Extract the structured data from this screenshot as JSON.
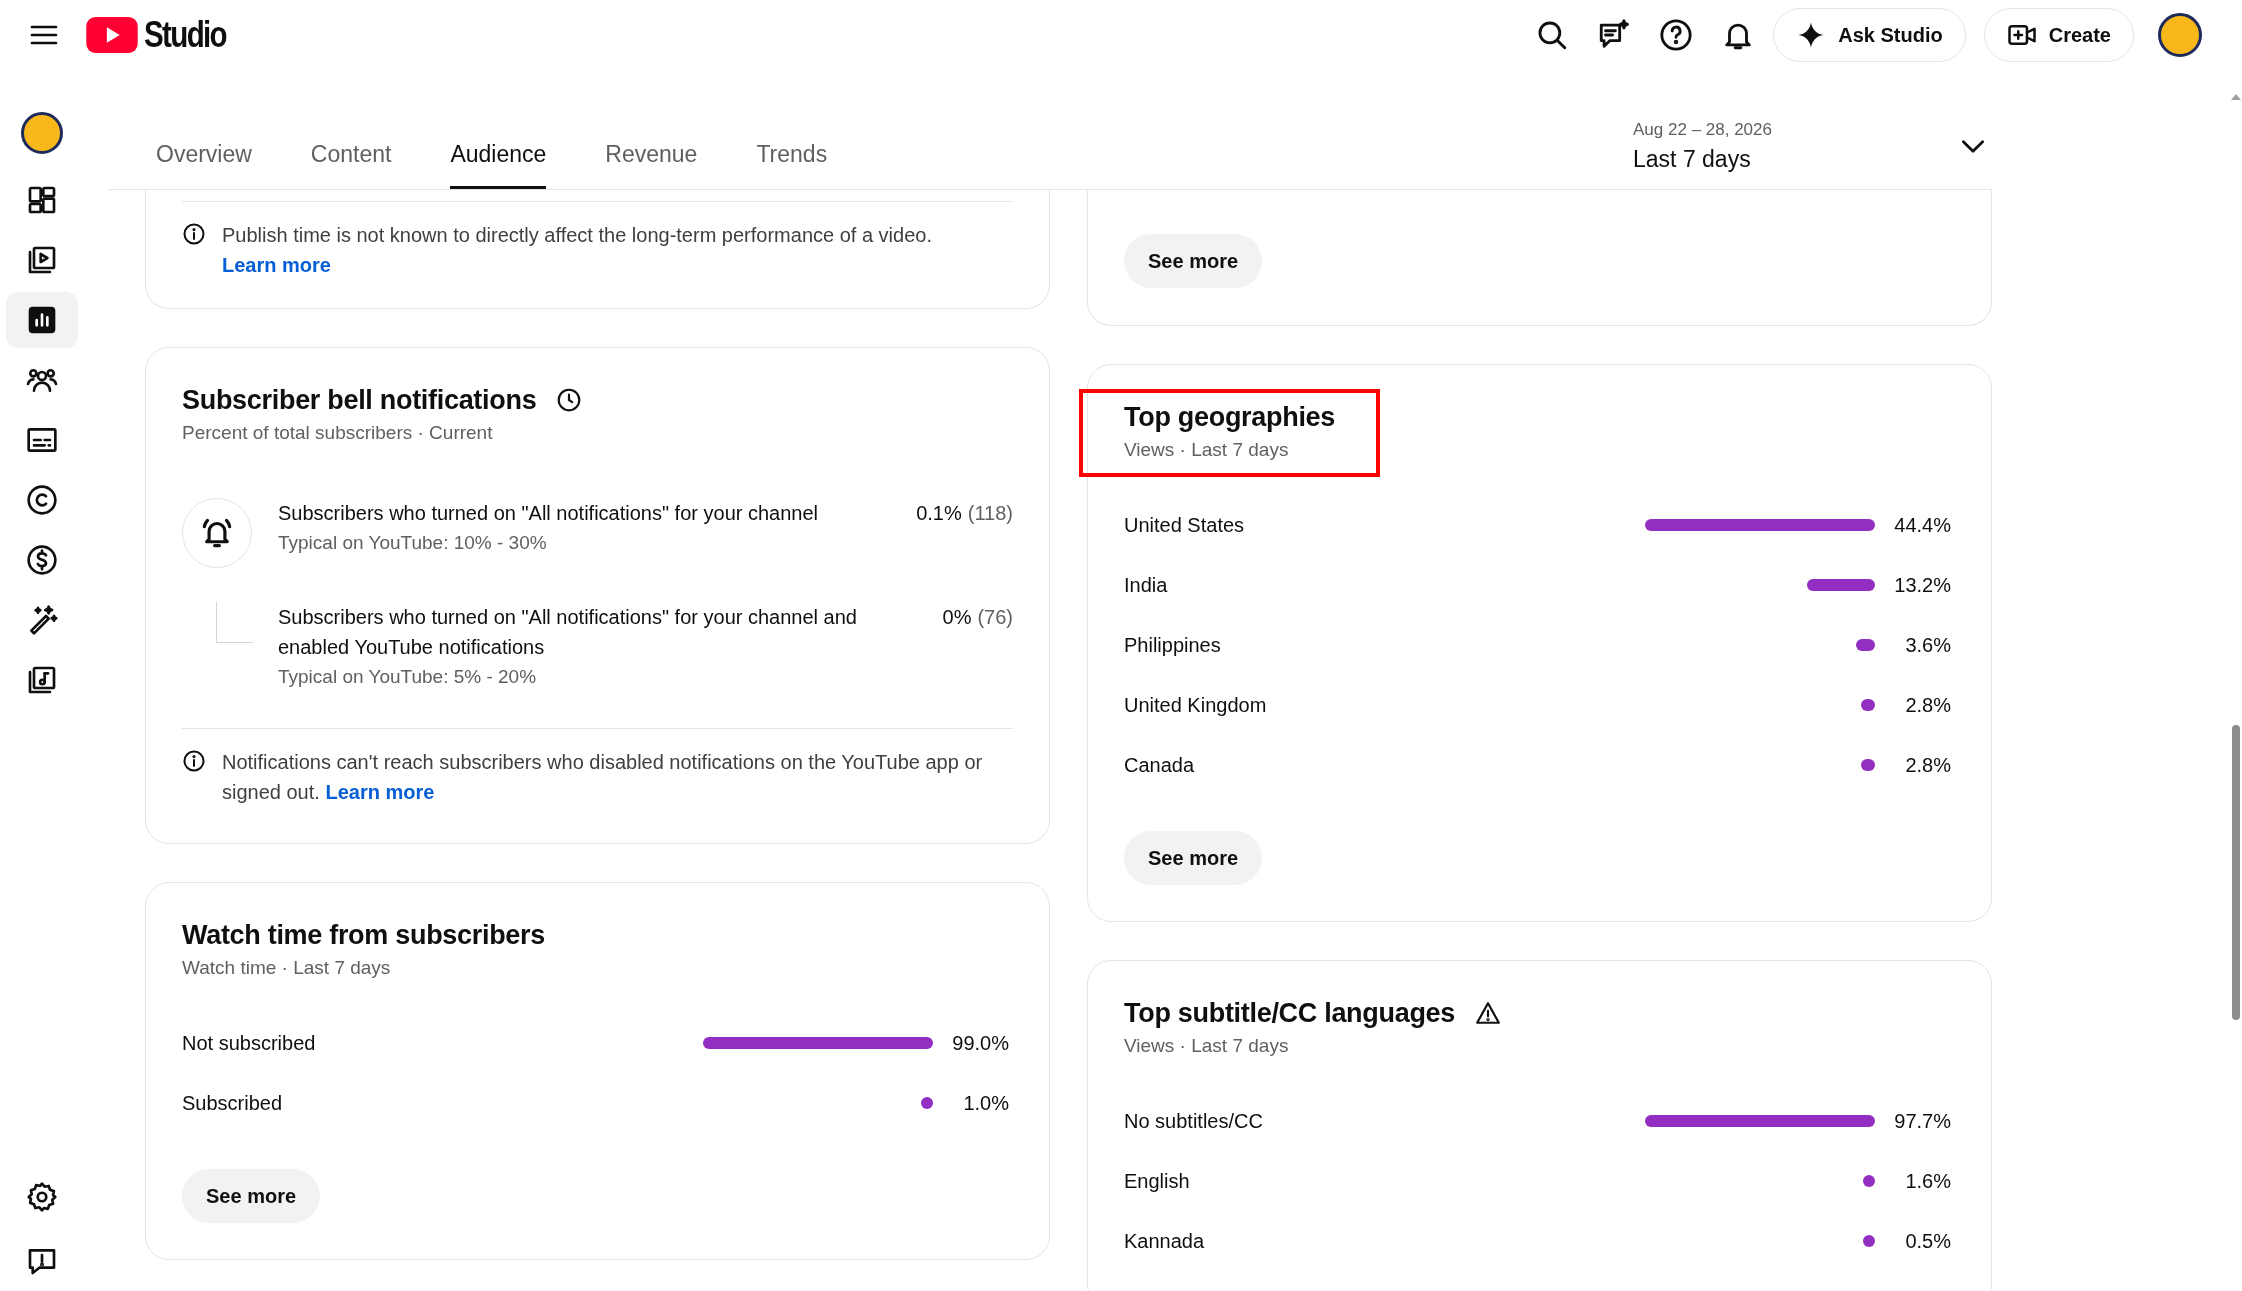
{
  "header": {
    "logo_text": "Studio",
    "ask_button": "Ask Studio",
    "create_button": "Create"
  },
  "sidebar": {
    "items": [
      {
        "kind": "dashboard",
        "selected": false
      },
      {
        "kind": "content",
        "selected": false
      },
      {
        "kind": "analytics",
        "selected": true
      },
      {
        "kind": "community",
        "selected": false
      },
      {
        "kind": "subtitles",
        "selected": false
      },
      {
        "kind": "copyright",
        "selected": false
      },
      {
        "kind": "earn",
        "selected": false
      },
      {
        "kind": "customization",
        "selected": false
      },
      {
        "kind": "audio_library",
        "selected": false
      }
    ],
    "bottom_items": [
      {
        "kind": "settings",
        "selected": false
      },
      {
        "kind": "feedback",
        "selected": false
      }
    ]
  },
  "tabs": [
    {
      "label": "Overview",
      "selected": false
    },
    {
      "label": "Content",
      "selected": false
    },
    {
      "label": "Audience",
      "selected": true
    },
    {
      "label": "Revenue",
      "selected": false
    },
    {
      "label": "Trends",
      "selected": false
    }
  ],
  "date_range": {
    "range": "Aug 22 – 28, 2026",
    "label": "Last 7 days"
  },
  "left_cards": [
    {
      "kind": "note",
      "note": "Publish time is not known to directly affect the long-term performance of a video.",
      "link": "Learn more"
    },
    {
      "kind": "bell",
      "title": "Subscriber bell notifications",
      "title_icon": {
        "kind": "clock"
      },
      "subtitle": "Percent of total subscribers · Current",
      "highlighted": false,
      "rows": [
        {
          "kind": "main",
          "label": "Subscribers who turned on \"All notifications\" for your channel",
          "typical": "Typical on YouTube: 10% - 30%",
          "value": "0.1%",
          "count": "(118)"
        },
        {
          "kind": "sub",
          "label": "Subscribers who turned on \"All notifications\" for your channel and enabled YouTube notifications",
          "typical": "Typical on YouTube: 5% - 20%",
          "value": "0%",
          "count": "(76)"
        }
      ],
      "note": "Notifications can't reach subscribers who disabled notifications on the YouTube app or signed out.",
      "link": "Learn more"
    },
    {
      "kind": "bars",
      "title": "Watch time from subscribers",
      "subtitle": "Watch time · Last 7 days",
      "highlighted": false,
      "rows": [
        {
          "label": "Not subscribed",
          "value": "99.0%"
        },
        {
          "label": "Subscribed",
          "value": "1.0%"
        }
      ],
      "button": "See more"
    }
  ],
  "right_cards": [
    {
      "kind": "more",
      "button": "See more"
    },
    {
      "kind": "bars",
      "title": "Top geographies",
      "subtitle": "Views · Last 7 days",
      "highlighted": true,
      "rows": [
        {
          "label": "United States",
          "value": "44.4%"
        },
        {
          "label": "India",
          "value": "13.2%"
        },
        {
          "label": "Philippines",
          "value": "3.6%"
        },
        {
          "label": "United Kingdom",
          "value": "2.8%"
        },
        {
          "label": "Canada",
          "value": "2.8%"
        }
      ],
      "button": "See more"
    },
    {
      "kind": "bars",
      "title": "Top subtitle/CC languages",
      "title_icon": {
        "kind": "warning"
      },
      "subtitle": "Views · Last 7 days",
      "highlighted": false,
      "rows": [
        {
          "label": "No subtitles/CC",
          "value": "97.7%"
        },
        {
          "label": "English",
          "value": "1.6%"
        },
        {
          "label": "Kannada",
          "value": "0.5%"
        }
      ]
    }
  ]
}
